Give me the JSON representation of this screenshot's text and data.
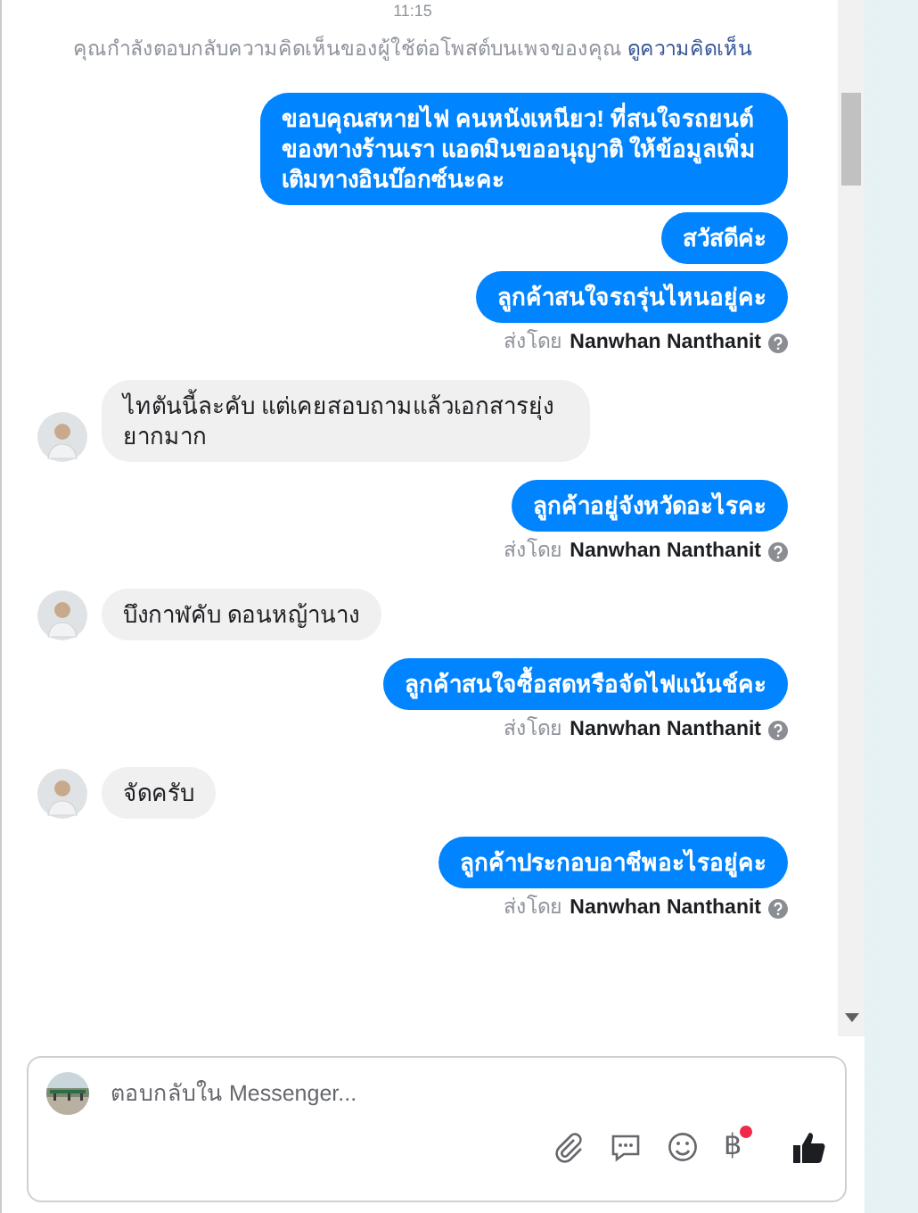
{
  "timestamp": "11:15",
  "notice": {
    "text": "คุณกำลังตอบกลับความคิดเห็นของผู้ใช้ต่อโพสต์บนเพจของคุณ",
    "link": "ดูความคิดเห็น"
  },
  "messages": [
    {
      "kind": "out",
      "text": "ขอบคุณสหายไฟ คนหนังเหนียว! ที่สนใจรถยนต์ของทางร้านเรา แอดมินขออนุญาติ ให้ข้อมูลเพิ่มเติมทางอินบ๊อกซ์นะคะ"
    },
    {
      "kind": "out",
      "text": "สวัสดีค่ะ"
    },
    {
      "kind": "out",
      "text": "ลูกค้าสนใจรถรุ่นไหนอยู่คะ"
    },
    {
      "kind": "sender",
      "label": "ส่งโดย",
      "name": "Nanwhan Nanthanit"
    },
    {
      "kind": "in",
      "text": "ไทตันนี้ละคับ แต่เคยสอบถามแล้วเอกสารยุ่งยากมาก"
    },
    {
      "kind": "out",
      "text": "ลูกค้าอยู่จังหวัดอะไรคะ"
    },
    {
      "kind": "sender",
      "label": "ส่งโดย",
      "name": "Nanwhan Nanthanit"
    },
    {
      "kind": "in",
      "text": "บึงกาฬคับ ดอนหญ้านาง"
    },
    {
      "kind": "out",
      "text": "ลูกค้าสนใจซื้อสดหรือจัดไฟแน้นช์คะ"
    },
    {
      "kind": "sender",
      "label": "ส่งโดย",
      "name": "Nanwhan Nanthanit"
    },
    {
      "kind": "in",
      "text": "จัดครับ"
    },
    {
      "kind": "out",
      "text": "ลูกค้าประกอบอาชีพอะไรอยู่คะ"
    },
    {
      "kind": "sender",
      "label": "ส่งโดย",
      "name": "Nanwhan Nanthanit"
    }
  ],
  "composer": {
    "placeholder": "ตอบกลับใน Messenger...",
    "currency": "฿",
    "currency_badge": true
  }
}
